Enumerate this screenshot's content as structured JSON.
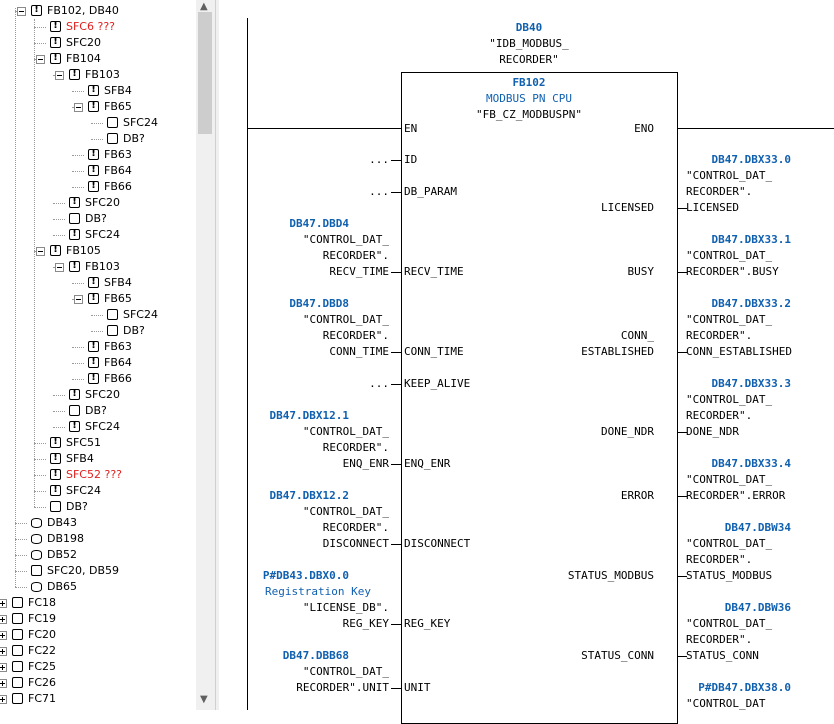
{
  "tree": {
    "items": [
      {
        "label": "FB102, DB40",
        "icon": "exclamation-box",
        "level": 1,
        "expander": "minus",
        "red": false
      },
      {
        "label": "SFC6 ???",
        "icon": "exclamation-box",
        "level": 2,
        "expander": "",
        "red": true
      },
      {
        "label": "SFC20",
        "icon": "exclamation-box",
        "level": 2,
        "expander": "",
        "red": false
      },
      {
        "label": "FB104",
        "icon": "exclamation-box",
        "level": 2,
        "expander": "minus",
        "red": false
      },
      {
        "label": "FB103",
        "icon": "exclamation-box",
        "level": 3,
        "expander": "minus",
        "red": false
      },
      {
        "label": "SFB4",
        "icon": "exclamation-box",
        "level": 4,
        "expander": "",
        "red": false
      },
      {
        "label": "FB65",
        "icon": "exclamation-box",
        "level": 4,
        "expander": "minus",
        "red": false
      },
      {
        "label": "SFC24",
        "icon": "box",
        "level": 5,
        "expander": "",
        "red": false
      },
      {
        "label": "DB?",
        "icon": "box",
        "level": 5,
        "expander": "",
        "red": false
      },
      {
        "label": "FB63",
        "icon": "exclamation-box",
        "level": 4,
        "expander": "",
        "red": false
      },
      {
        "label": "FB64",
        "icon": "exclamation-box",
        "level": 4,
        "expander": "",
        "red": false
      },
      {
        "label": "FB66",
        "icon": "exclamation-box",
        "level": 4,
        "expander": "",
        "red": false
      },
      {
        "label": "SFC20",
        "icon": "exclamation-box",
        "level": 3,
        "expander": "",
        "red": false
      },
      {
        "label": "DB?",
        "icon": "box",
        "level": 3,
        "expander": "",
        "red": false
      },
      {
        "label": "SFC24",
        "icon": "exclamation-box",
        "level": 3,
        "expander": "",
        "red": false
      },
      {
        "label": "FB105",
        "icon": "exclamation-box",
        "level": 2,
        "expander": "minus",
        "red": false
      },
      {
        "label": "FB103",
        "icon": "exclamation-box",
        "level": 3,
        "expander": "minus",
        "red": false
      },
      {
        "label": "SFB4",
        "icon": "exclamation-box",
        "level": 4,
        "expander": "",
        "red": false
      },
      {
        "label": "FB65",
        "icon": "exclamation-box",
        "level": 4,
        "expander": "minus",
        "red": false
      },
      {
        "label": "SFC24",
        "icon": "box",
        "level": 5,
        "expander": "",
        "red": false
      },
      {
        "label": "DB?",
        "icon": "box",
        "level": 5,
        "expander": "",
        "red": false
      },
      {
        "label": "FB63",
        "icon": "exclamation-box",
        "level": 4,
        "expander": "",
        "red": false
      },
      {
        "label": "FB64",
        "icon": "exclamation-box",
        "level": 4,
        "expander": "",
        "red": false
      },
      {
        "label": "FB66",
        "icon": "exclamation-box",
        "level": 4,
        "expander": "",
        "red": false
      },
      {
        "label": "SFC20",
        "icon": "exclamation-box",
        "level": 3,
        "expander": "",
        "red": false
      },
      {
        "label": "DB?",
        "icon": "box",
        "level": 3,
        "expander": "",
        "red": false
      },
      {
        "label": "SFC24",
        "icon": "exclamation-box",
        "level": 3,
        "expander": "",
        "red": false
      },
      {
        "label": "SFC51",
        "icon": "exclamation-box",
        "level": 2,
        "expander": "",
        "red": false
      },
      {
        "label": "SFB4",
        "icon": "exclamation-box",
        "level": 2,
        "expander": "",
        "red": false
      },
      {
        "label": "SFC52 ???",
        "icon": "exclamation-box",
        "level": 2,
        "expander": "",
        "red": true
      },
      {
        "label": "SFC24",
        "icon": "exclamation-box",
        "level": 2,
        "expander": "",
        "red": false
      },
      {
        "label": "DB?",
        "icon": "box",
        "level": 2,
        "expander": "",
        "red": false
      },
      {
        "label": "DB43",
        "icon": "db-cylinder",
        "level": 1,
        "expander": "",
        "red": false
      },
      {
        "label": "DB198",
        "icon": "db-cylinder",
        "level": 1,
        "expander": "",
        "red": false
      },
      {
        "label": "DB52",
        "icon": "db-cylinder",
        "level": 1,
        "expander": "",
        "red": false
      },
      {
        "label": "SFC20, DB59",
        "icon": "box",
        "level": 1,
        "expander": "",
        "red": false
      },
      {
        "label": "DB65",
        "icon": "db-cylinder",
        "level": 1,
        "expander": "",
        "red": false
      },
      {
        "label": "FC18",
        "icon": "box",
        "level": 0,
        "expander": "plus",
        "red": false
      },
      {
        "label": "FC19",
        "icon": "box",
        "level": 0,
        "expander": "plus",
        "red": false
      },
      {
        "label": "FC20",
        "icon": "box",
        "level": 0,
        "expander": "plus",
        "red": false
      },
      {
        "label": "FC22",
        "icon": "box",
        "level": 0,
        "expander": "plus",
        "red": false
      },
      {
        "label": "FC25",
        "icon": "box",
        "level": 0,
        "expander": "plus",
        "red": false
      },
      {
        "label": "FC26",
        "icon": "box",
        "level": 0,
        "expander": "plus",
        "red": false
      },
      {
        "label": "FC71",
        "icon": "box",
        "level": 0,
        "expander": "plus",
        "red": false
      }
    ]
  },
  "block": {
    "instance_db": "DB40",
    "instance_symbol": [
      "\"IDB_MODBUS_",
      "RECORDER\""
    ],
    "fb_number": "FB102",
    "fb_family": "MODBUS PN CPU",
    "fb_symbol": "\"FB_CZ_MODBUSPN\"",
    "en": "EN",
    "eno": "ENO"
  },
  "inputs": [
    {
      "pin": "ID",
      "addr": "",
      "sym": [],
      "tail": "...",
      "extra": ""
    },
    {
      "pin": "DB_PARAM",
      "addr": "",
      "sym": [],
      "tail": "...",
      "extra": ""
    },
    {
      "pin": "RECV_TIME",
      "addr": "DB47.DBD4",
      "sym": [
        "\"CONTROL_DAT_",
        "RECORDER\"."
      ],
      "tail": "RECV_TIME",
      "extra": ""
    },
    {
      "pin": "CONN_TIME",
      "addr": "DB47.DBD8",
      "sym": [
        "\"CONTROL_DAT_",
        "RECORDER\"."
      ],
      "tail": "CONN_TIME",
      "extra": ""
    },
    {
      "pin": "KEEP_ALIVE",
      "addr": "",
      "sym": [],
      "tail": "...",
      "extra": ""
    },
    {
      "pin": "ENQ_ENR",
      "addr": "DB47.DBX12.1",
      "sym": [
        "\"CONTROL_DAT_",
        "RECORDER\"."
      ],
      "tail": "ENQ_ENR",
      "extra": ""
    },
    {
      "pin": "DISCONNECT",
      "addr": "DB47.DBX12.2",
      "sym": [
        "\"CONTROL_DAT_",
        "RECORDER\"."
      ],
      "tail": "DISCONNECT",
      "extra": ""
    },
    {
      "pin": "REG_KEY",
      "addr": "P#DB43.DBX0.0",
      "sym": [
        "\"LICENSE_DB\"."
      ],
      "tail": "REG_KEY",
      "extra": "Registration Key"
    },
    {
      "pin": "UNIT",
      "addr": "DB47.DBB68",
      "sym": [
        "\"CONTROL_DAT_"
      ],
      "tail": "RECORDER\".UNIT",
      "extra": ""
    }
  ],
  "outputs": [
    {
      "pin": "LICENSED",
      "addr": "DB47.DBX33.0",
      "sym": [
        "\"CONTROL_DAT_",
        "RECORDER\"."
      ],
      "tail": "LICENSED"
    },
    {
      "pin": "BUSY",
      "addr": "DB47.DBX33.1",
      "sym": [
        "\"CONTROL_DAT_"
      ],
      "tail": "RECORDER\".BUSY"
    },
    {
      "pin": "CONN_",
      "pin2": "ESTABLISHED",
      "addr": "DB47.DBX33.2",
      "sym": [
        "\"CONTROL_DAT_",
        "RECORDER\"."
      ],
      "tail": "CONN_ESTABLISHED"
    },
    {
      "pin": "DONE_NDR",
      "addr": "DB47.DBX33.3",
      "sym": [
        "\"CONTROL_DAT_",
        "RECORDER\"."
      ],
      "tail": "DONE_NDR"
    },
    {
      "pin": "ERROR",
      "addr": "DB47.DBX33.4",
      "sym": [
        "\"CONTROL_DAT_"
      ],
      "tail": "RECORDER\".ERROR"
    },
    {
      "pin": "STATUS_MODBUS",
      "addr": "DB47.DBW34",
      "sym": [
        "\"CONTROL_DAT_",
        "RECORDER\"."
      ],
      "tail": "STATUS_MODBUS"
    },
    {
      "pin": "STATUS_CONN",
      "addr": "DB47.DBW36",
      "sym": [
        "\"CONTROL_DAT_",
        "RECORDER\"."
      ],
      "tail": "STATUS_CONN"
    },
    {
      "pin": "",
      "addr": "P#DB47.DBX38.0",
      "sym": [
        "\"CONTROL_DAT"
      ],
      "tail": ""
    }
  ],
  "colors": {
    "address": "#1060b0",
    "warning": "#e02020"
  }
}
